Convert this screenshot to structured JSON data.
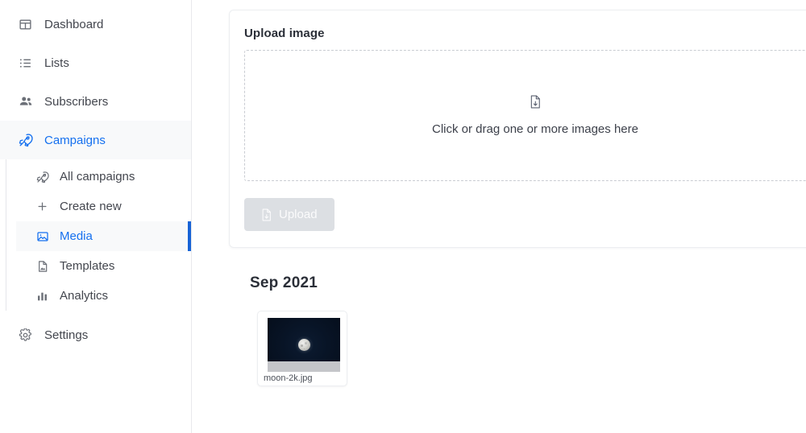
{
  "sidebar": {
    "items": [
      {
        "id": "dashboard",
        "label": "Dashboard",
        "icon": "dashboard-icon",
        "active": false
      },
      {
        "id": "lists",
        "label": "Lists",
        "icon": "list-icon",
        "active": false
      },
      {
        "id": "subscribers",
        "label": "Subscribers",
        "icon": "users-icon",
        "active": false
      },
      {
        "id": "campaigns",
        "label": "Campaigns",
        "icon": "rocket-icon",
        "active": true
      }
    ],
    "submenu": [
      {
        "id": "all-campaigns",
        "label": "All campaigns",
        "icon": "rocket-icon",
        "active": false
      },
      {
        "id": "create-new",
        "label": "Create new",
        "icon": "plus-icon",
        "active": false
      },
      {
        "id": "media",
        "label": "Media",
        "icon": "image-icon",
        "active": true
      },
      {
        "id": "templates",
        "label": "Templates",
        "icon": "file-image-icon",
        "active": false
      },
      {
        "id": "analytics",
        "label": "Analytics",
        "icon": "bar-chart-icon",
        "active": false
      }
    ],
    "settings": {
      "id": "settings",
      "label": "Settings",
      "icon": "gear-icon",
      "active": false
    },
    "accent_color": "#1570ef",
    "active_marker_color": "#1763d6"
  },
  "upload_card": {
    "title": "Upload image",
    "dropzone": {
      "text": "Click or drag one or more images here",
      "icon": "file-upload-icon"
    },
    "upload_button": {
      "label": "Upload",
      "icon": "file-upload-icon",
      "disabled": true
    }
  },
  "gallery": {
    "groups": [
      {
        "title": "Sep 2021",
        "items": [
          {
            "filename": "moon-2k.jpg",
            "alt": "moon-2k.jpg"
          }
        ]
      }
    ]
  }
}
